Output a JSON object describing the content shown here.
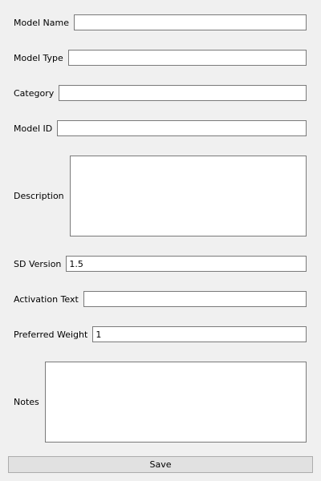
{
  "form": {
    "model_name": {
      "label": "Model Name",
      "value": ""
    },
    "model_type": {
      "label": "Model Type",
      "value": ""
    },
    "category": {
      "label": "Category",
      "value": ""
    },
    "model_id": {
      "label": "Model ID",
      "value": ""
    },
    "description": {
      "label": "Description",
      "value": ""
    },
    "sd_version": {
      "label": "SD Version",
      "value": "1.5"
    },
    "activation_text": {
      "label": "Activation Text",
      "value": ""
    },
    "preferred_weight": {
      "label": "Preferred Weight",
      "value": "1"
    },
    "notes": {
      "label": "Notes",
      "value": ""
    }
  },
  "actions": {
    "save_label": "Save"
  }
}
